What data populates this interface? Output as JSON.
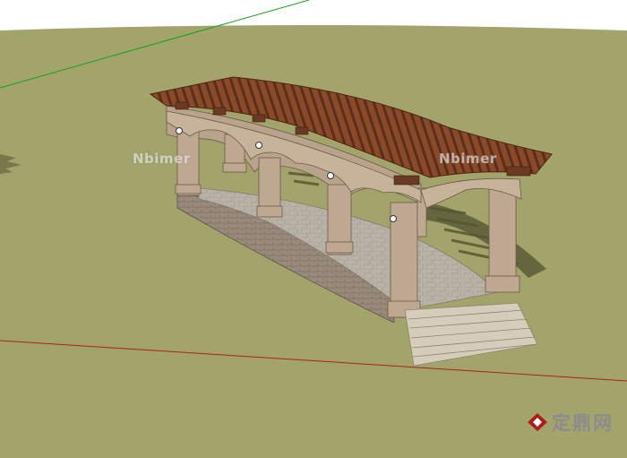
{
  "watermarks": {
    "left": "Nbimer",
    "right": "Nbimer"
  },
  "logo": {
    "text": "定鼎网",
    "icon": "diamond-logo-icon",
    "color": "#b11d1d"
  },
  "colors": {
    "sky": "#ffffff",
    "ground": "#a3a46b",
    "wood": "#8a4a2a",
    "stucco": "#b9a38c",
    "stone_floor": "#b8b3a6",
    "brick": "#9a8a7c",
    "axis_green": "#1aa11a",
    "axis_red": "#b02020"
  }
}
